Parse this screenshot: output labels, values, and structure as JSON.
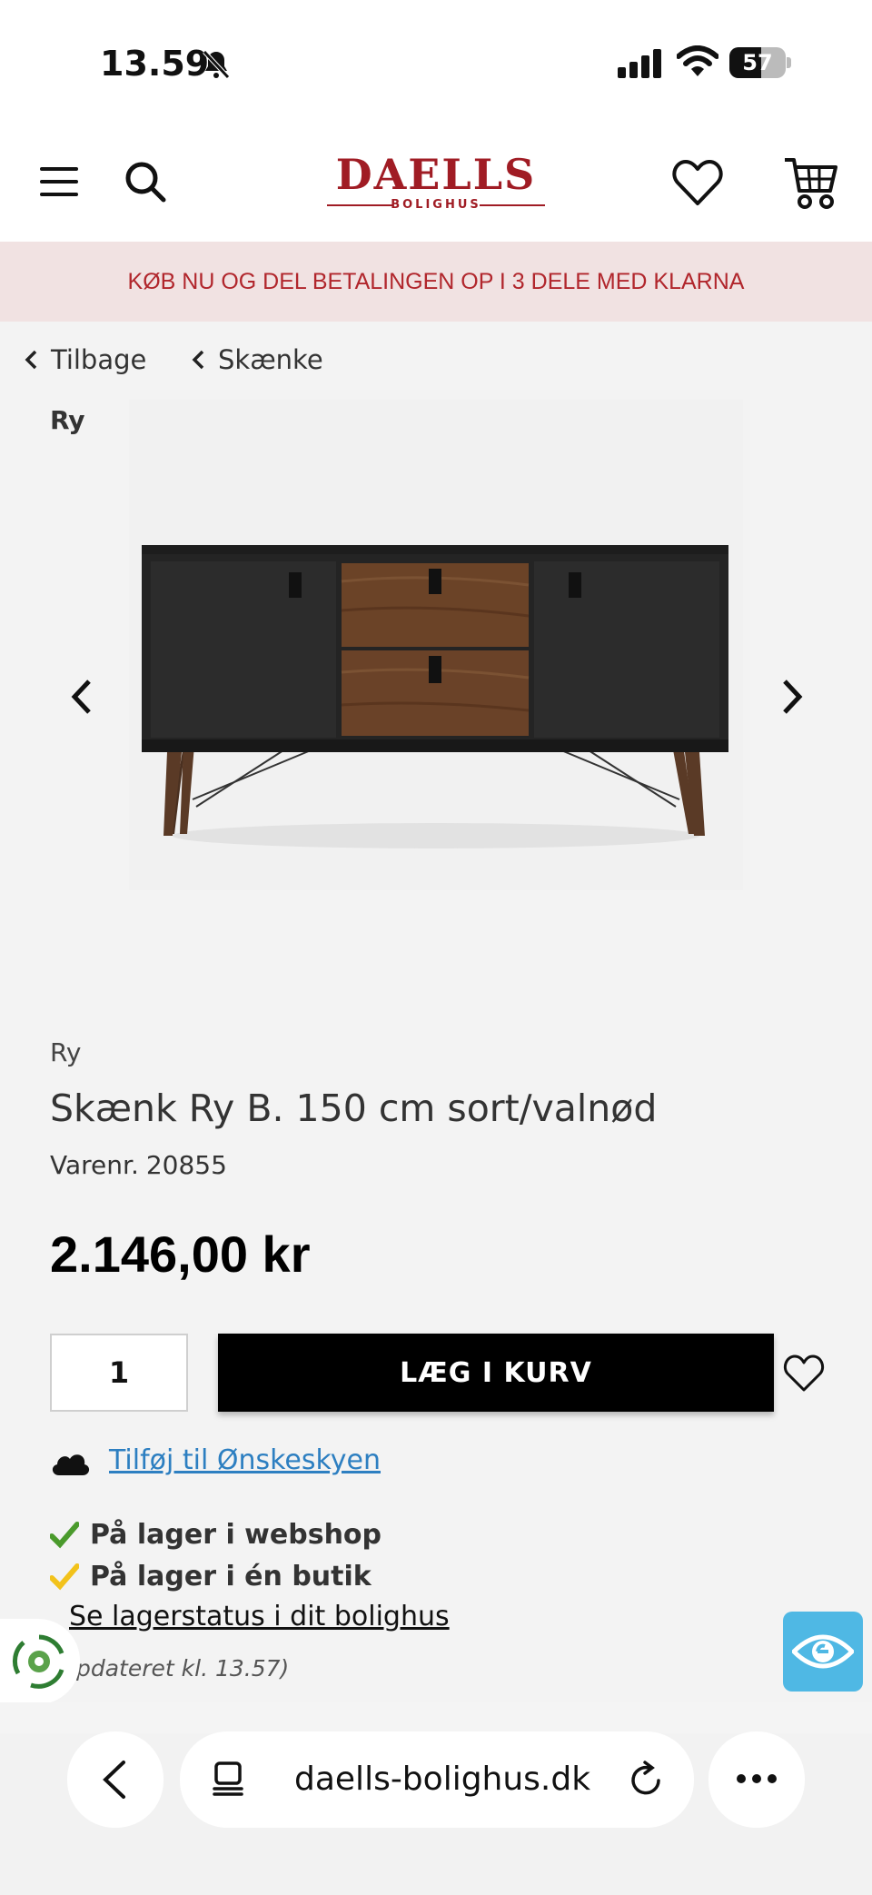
{
  "status_bar": {
    "time": "13.59",
    "battery_level": "57",
    "battery_fraction": 0.57
  },
  "header": {
    "logo_brand": "DAELLS",
    "logo_sub": "BOLIGHUS",
    "icons": [
      "menu-icon",
      "search-icon",
      "heart-icon",
      "cart-icon"
    ]
  },
  "promo": {
    "text": "KØB NU OG DEL BETALINGEN OP I 3 DELE MED KLARNA"
  },
  "breadcrumb": {
    "back_label": "Tilbage",
    "category_label": "Skænke"
  },
  "gallery": {
    "brand_tag": "Ry"
  },
  "product": {
    "brand": "Ry",
    "title": "Skænk Ry B. 150 cm sort/valnød",
    "sku_label": "Varenr.",
    "sku": "20855",
    "price": "2.146,00 kr"
  },
  "cart": {
    "quantity": "1",
    "add_label": "LÆG I KURV"
  },
  "wishcloud": {
    "link_label": "Tilføj til Ønskeskyen"
  },
  "stock": {
    "webshop_label": "På lager i webshop",
    "store_label": "På lager i én butik",
    "status_link": "Se lagerstatus i dit bolighus",
    "updated_text": "pdateret kl. 13.57)"
  },
  "colors": {
    "brand_red": "#a01c24",
    "promo_bg": "#f1e2e2",
    "link_blue": "#2d7fc1",
    "check_green": "#4a9a2c",
    "check_yellow": "#f2c21b",
    "eye_badge": "#4fb8e4"
  },
  "browser": {
    "domain": "daells-bolighus.dk"
  }
}
